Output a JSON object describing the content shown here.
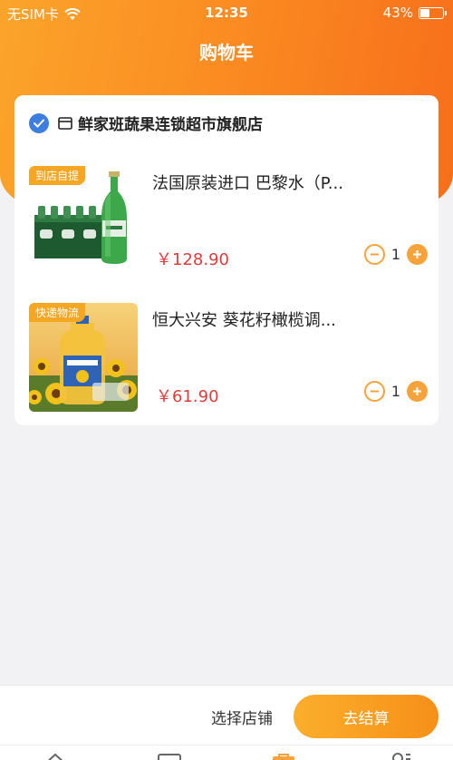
{
  "status_bar": {
    "carrier": "无SIM卡",
    "time": "12:35",
    "battery": "43%",
    "battery_level": 0.43
  },
  "header": {
    "title": "购物车"
  },
  "store": {
    "name": "鲜家班蔬果连锁超市旗舰店",
    "checked": true
  },
  "items": [
    {
      "tag": "到店自提",
      "title": "法国原装进口 巴黎水（P...",
      "price": "￥128.90",
      "qty": "1"
    },
    {
      "tag": "快递物流",
      "title": "恒大兴安 葵花籽橄榄调...",
      "price": "￥61.90",
      "qty": "1"
    }
  ],
  "footer": {
    "select_store": "选择店铺",
    "checkout": "去结算"
  },
  "colors": {
    "accent": "#f7a33c",
    "check_blue": "#3d7fe0",
    "price_red": "#e03b3b"
  },
  "tabbar": {
    "icons": [
      "home-icon",
      "message-icon",
      "cart-icon",
      "profile-icon"
    ]
  }
}
